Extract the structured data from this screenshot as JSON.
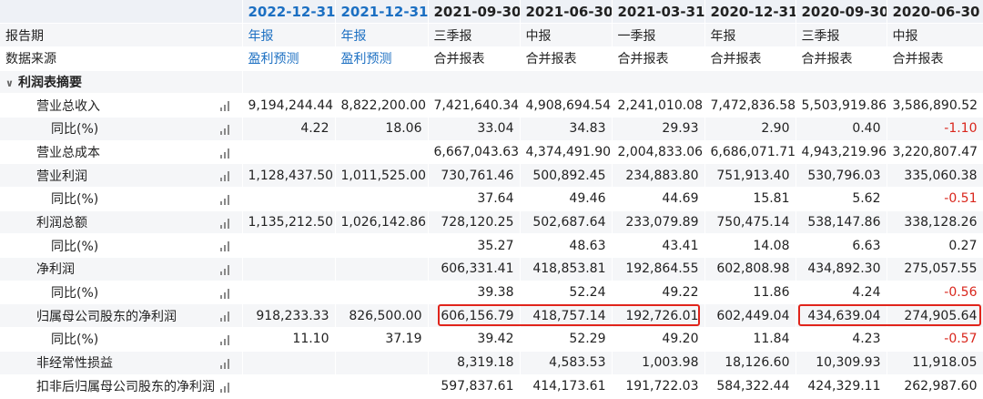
{
  "columns": [
    {
      "date": "2022-12-31",
      "type": "年报",
      "source": "盈利预测",
      "estimate": true
    },
    {
      "date": "2021-12-31",
      "type": "年报",
      "source": "盈利预测",
      "estimate": true
    },
    {
      "date": "2021-09-30",
      "type": "三季报",
      "source": "合并报表",
      "estimate": false
    },
    {
      "date": "2021-06-30",
      "type": "中报",
      "source": "合并报表",
      "estimate": false
    },
    {
      "date": "2021-03-31",
      "type": "一季报",
      "source": "合并报表",
      "estimate": false
    },
    {
      "date": "2020-12-31",
      "type": "年报",
      "source": "合并报表",
      "estimate": false
    },
    {
      "date": "2020-09-30",
      "type": "三季报",
      "source": "合并报表",
      "estimate": false
    },
    {
      "date": "2020-06-30",
      "type": "中报",
      "source": "合并报表",
      "estimate": false
    }
  ],
  "labels": {
    "report_period": "报告期",
    "data_source": "数据来源",
    "section": "利润表摘要"
  },
  "rows": [
    {
      "label": "营业总收入",
      "level": 1,
      "values": [
        "9,194,244.44",
        "8,822,200.00",
        "7,421,640.34",
        "4,908,694.54",
        "2,241,010.08",
        "7,472,836.58",
        "5,503,919.86",
        "3,586,890.52"
      ]
    },
    {
      "label": "同比(%)",
      "level": 2,
      "values": [
        "4.22",
        "18.06",
        "33.04",
        "34.83",
        "29.93",
        "2.90",
        "0.40",
        "-1.10"
      ]
    },
    {
      "label": "营业总成本",
      "level": 1,
      "values": [
        "",
        "",
        "6,667,043.63",
        "4,374,491.90",
        "2,004,833.06",
        "6,686,071.71",
        "4,943,219.96",
        "3,220,807.47"
      ]
    },
    {
      "label": "营业利润",
      "level": 1,
      "values": [
        "1,128,437.50",
        "1,011,525.00",
        "730,761.46",
        "500,892.45",
        "234,883.80",
        "751,913.40",
        "530,796.03",
        "335,060.38"
      ]
    },
    {
      "label": "同比(%)",
      "level": 2,
      "values": [
        "",
        "",
        "37.64",
        "49.46",
        "44.69",
        "15.81",
        "5.62",
        "-0.51"
      ]
    },
    {
      "label": "利润总额",
      "level": 1,
      "values": [
        "1,135,212.50",
        "1,026,142.86",
        "728,120.25",
        "502,687.64",
        "233,079.89",
        "750,475.14",
        "538,147.86",
        "338,128.26"
      ]
    },
    {
      "label": "同比(%)",
      "level": 2,
      "values": [
        "",
        "",
        "35.27",
        "48.63",
        "43.41",
        "14.08",
        "6.63",
        "0.27"
      ]
    },
    {
      "label": "净利润",
      "level": 1,
      "values": [
        "",
        "",
        "606,331.41",
        "418,853.81",
        "192,864.55",
        "602,808.98",
        "434,892.30",
        "275,057.55"
      ]
    },
    {
      "label": "同比(%)",
      "level": 2,
      "values": [
        "",
        "",
        "39.38",
        "52.24",
        "49.22",
        "11.86",
        "4.24",
        "-0.56"
      ]
    },
    {
      "label": "归属母公司股东的净利润",
      "level": 1,
      "values": [
        "918,233.33",
        "826,500.00",
        "606,156.79",
        "418,757.14",
        "192,726.01",
        "602,449.04",
        "434,639.04",
        "274,905.64"
      ]
    },
    {
      "label": "同比(%)",
      "level": 2,
      "values": [
        "11.10",
        "37.19",
        "39.42",
        "52.29",
        "49.20",
        "11.84",
        "4.23",
        "-0.57"
      ]
    },
    {
      "label": "非经常性损益",
      "level": 1,
      "values": [
        "",
        "",
        "8,319.18",
        "4,583.53",
        "1,003.98",
        "18,126.60",
        "10,309.93",
        "11,918.05"
      ]
    },
    {
      "label": "扣非后归属母公司股东的净利润",
      "level": 1,
      "values": [
        "",
        "",
        "597,837.61",
        "414,173.61",
        "191,722.03",
        "584,322.44",
        "424,329.11",
        "262,987.60"
      ]
    }
  ],
  "colors": {
    "estimate_text": "#1b6fc2",
    "negative_text": "#d9261c",
    "highlight_box": "#e0241b"
  },
  "icons": {
    "row_chart": "bar-chart-icon",
    "section_toggle": "chevron-down-icon"
  }
}
